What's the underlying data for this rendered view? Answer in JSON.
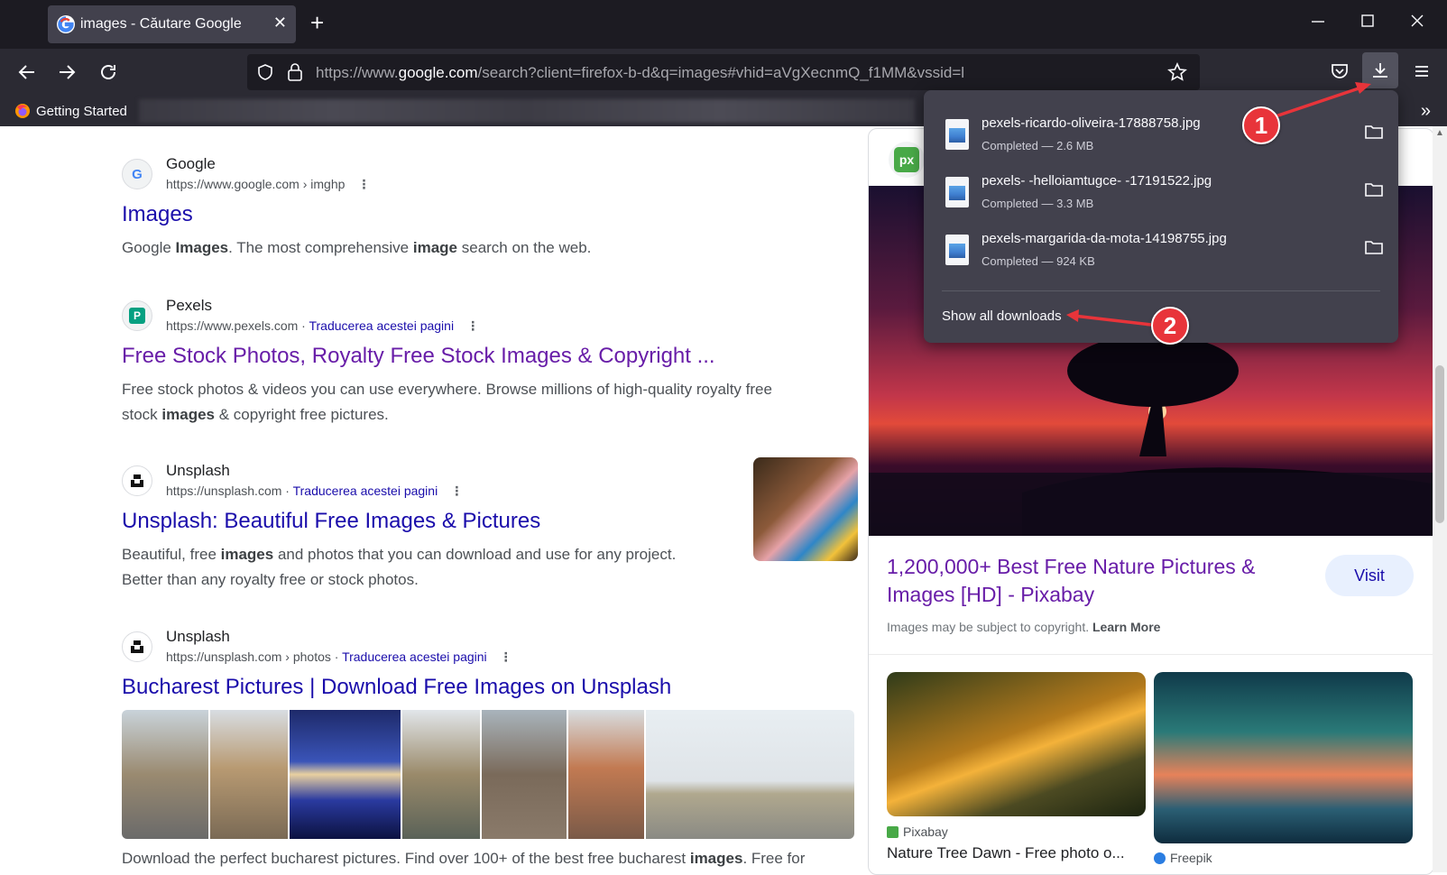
{
  "browser": {
    "tab_title": "images - Căutare Google",
    "url_base": "https://www.",
    "url_domain": "google.com",
    "url_rest": "/search?client=firefox-b-d&q=images#vhid=aVgXecnmQ_f1MM&vssid=l",
    "bookmark_label": "Getting Started"
  },
  "results": [
    {
      "site": "Google",
      "url": "https://www.google.com › imghp",
      "translate": "",
      "title": "Images",
      "snippet_parts": [
        "Google ",
        "Images",
        ". The most comprehensive ",
        "image",
        " search on the web."
      ]
    },
    {
      "site": "Pexels",
      "url": "https://www.pexels.com",
      "translate": "Traducerea acestei pagini",
      "title": "Free Stock Photos, Royalty Free Stock Images & Copyright ...",
      "snippet_line1": "Free stock photos & videos you can use everywhere. Browse millions of high-quality royalty free",
      "snippet_line2_a": "stock ",
      "snippet_line2_b": "images",
      "snippet_line2_c": " & copyright free pictures."
    },
    {
      "site": "Unsplash",
      "url": "https://unsplash.com",
      "translate": "Traducerea acestei pagini",
      "title": "Unsplash: Beautiful Free Images & Pictures",
      "snippet_line1_a": "Beautiful, free ",
      "snippet_line1_b": "images",
      "snippet_line1_c": " and photos that you can download and use for any project.",
      "snippet_line2": "Better than any royalty free or stock photos."
    },
    {
      "site": "Unsplash",
      "url": "https://unsplash.com › photos",
      "translate": "Traducerea acestei pagini",
      "title": "Bucharest Pictures | Download Free Images on Unsplash",
      "snippet_a": "Download the perfect bucharest pictures. Find over 100+ of the best free bucharest ",
      "snippet_b": "images",
      "snippet_c": ". Free for"
    }
  ],
  "panel": {
    "title": "1,200,000+ Best Free Nature Pictures & Images [HD] - Pixabay",
    "visit_label": "Visit",
    "copyright_text": "Images may be subject to copyright. ",
    "learn_more": "Learn More",
    "image1_source": "Pixabay",
    "image1_caption": "Nature Tree Dawn - Free photo o...",
    "image2_source": "Freepik"
  },
  "downloads": {
    "items": [
      {
        "name": "pexels-ricardo-oliveira-17888758.jpg",
        "status": "Completed — 2.6 MB"
      },
      {
        "name": "pexels- -helloiamtugce- -17191522.jpg",
        "status": "Completed — 3.3 MB"
      },
      {
        "name": "pexels-margarida-da-mota-14198755.jpg",
        "status": "Completed — 924 KB"
      }
    ],
    "show_all": "Show all downloads"
  },
  "annotations": {
    "badge1": "1",
    "badge2": "2",
    "color": "#e8343a"
  }
}
